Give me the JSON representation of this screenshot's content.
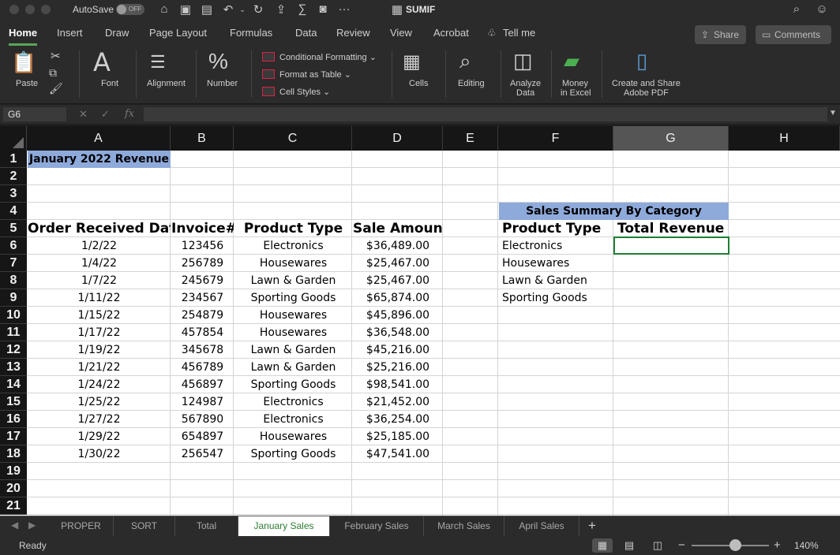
{
  "titlebar": {
    "autosave_label": "AutoSave",
    "autosave_state": "OFF",
    "document_title": "SUMIF"
  },
  "menu": {
    "tabs": [
      "Home",
      "Insert",
      "Draw",
      "Page Layout",
      "Formulas",
      "Data",
      "Review",
      "View",
      "Acrobat"
    ],
    "tell_me": "Tell me",
    "share": "Share",
    "comments": "Comments"
  },
  "ribbon": {
    "paste": "Paste",
    "font": "Font",
    "alignment": "Alignment",
    "number": "Number",
    "conditional_formatting": "Conditional Formatting",
    "format_as_table": "Format as Table",
    "cell_styles": "Cell Styles",
    "cells": "Cells",
    "editing": "Editing",
    "analyze_data": [
      "Analyze",
      "Data"
    ],
    "money_in_excel": [
      "Money",
      "in Excel"
    ],
    "adobe_pdf": [
      "Create and Share",
      "Adobe PDF"
    ]
  },
  "formula_bar": {
    "name_box": "G6",
    "fx": "fx",
    "formula": ""
  },
  "grid": {
    "columns": [
      "A",
      "B",
      "C",
      "D",
      "E",
      "F",
      "G",
      "H"
    ],
    "selected_column": "G",
    "rows": [
      "1",
      "2",
      "3",
      "4",
      "5",
      "6",
      "7",
      "8",
      "9",
      "10",
      "11",
      "12",
      "13",
      "14",
      "15",
      "16",
      "17",
      "18",
      "19",
      "20",
      "21"
    ],
    "title": "January 2022 Revenue",
    "headers": [
      "Order Received Date",
      "Invoice#",
      "Product Type",
      "Sale Amount"
    ],
    "data": [
      [
        "1/2/22",
        "123456",
        "Electronics",
        "$36,489.00"
      ],
      [
        "1/4/22",
        "256789",
        "Housewares",
        "$25,467.00"
      ],
      [
        "1/7/22",
        "245679",
        "Lawn & Garden",
        "$25,467.00"
      ],
      [
        "1/11/22",
        "234567",
        "Sporting Goods",
        "$65,874.00"
      ],
      [
        "1/15/22",
        "254879",
        "Housewares",
        "$45,896.00"
      ],
      [
        "1/17/22",
        "457854",
        "Housewares",
        "$36,548.00"
      ],
      [
        "1/19/22",
        "345678",
        "Lawn & Garden",
        "$45,216.00"
      ],
      [
        "1/21/22",
        "456789",
        "Lawn & Garden",
        "$25,216.00"
      ],
      [
        "1/24/22",
        "456897",
        "Sporting Goods",
        "$98,541.00"
      ],
      [
        "1/25/22",
        "124987",
        "Electronics",
        "$21,452.00"
      ],
      [
        "1/27/22",
        "567890",
        "Electronics",
        "$36,254.00"
      ],
      [
        "1/29/22",
        "654897",
        "Housewares",
        "$25,185.00"
      ],
      [
        "1/30/22",
        "256547",
        "Sporting Goods",
        "$47,541.00"
      ]
    ],
    "summary": {
      "title": "Sales Summary By Category",
      "header_product": "Product Type",
      "header_revenue": "Total Revenue",
      "categories": [
        "Electronics",
        "Housewares",
        "Lawn & Garden",
        "Sporting Goods"
      ]
    }
  },
  "sheets": {
    "tabs": [
      "PROPER",
      "SORT",
      "Total",
      "January Sales",
      "February Sales",
      "March Sales",
      "April Sales"
    ],
    "active": "January Sales"
  },
  "status": {
    "text": "Ready",
    "zoom": "140%"
  },
  "colors": {
    "accent_green": "#2e7d32",
    "highlight_blue": "#8eaadb",
    "chrome_dark": "#2b2b2b"
  }
}
